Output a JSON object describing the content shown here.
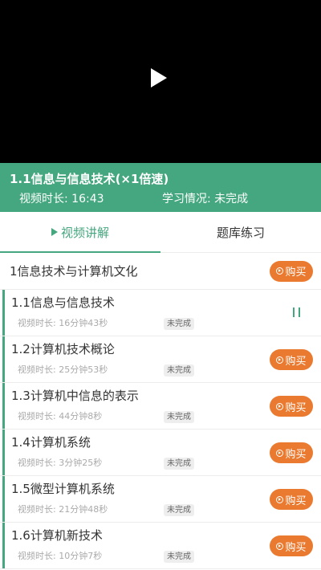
{
  "player": {
    "play_icon": "play-icon"
  },
  "info": {
    "title": "1.1信息与信息技术(×1倍速)",
    "duration_label": "视频时长:",
    "duration": "16:43",
    "progress_label": "学习情况:",
    "progress": "未完成"
  },
  "tabs": [
    {
      "label": "视频讲解",
      "active": true
    },
    {
      "label": "题库练习",
      "active": false
    }
  ],
  "chapter": {
    "title": "1信息技术与计算机文化",
    "buy_label": "购买"
  },
  "lessons": [
    {
      "name": "1.1信息与信息技术",
      "duration": "视频时长: 16分钟43秒",
      "status": "未完成",
      "action": "pause"
    },
    {
      "name": "1.2计算机技术概论",
      "duration": "视频时长: 25分钟53秒",
      "status": "未完成",
      "action": "buy",
      "buy_label": "购买"
    },
    {
      "name": "1.3计算机中信息的表示",
      "duration": "视频时长: 44分钟8秒",
      "status": "未完成",
      "action": "buy",
      "buy_label": "购买"
    },
    {
      "name": "1.4计算机系统",
      "duration": "视频时长: 3分钟25秒",
      "status": "未完成",
      "action": "buy",
      "buy_label": "购买"
    },
    {
      "name": "1.5微型计算机系统",
      "duration": "视频时长: 21分钟48秒",
      "status": "未完成",
      "action": "buy",
      "buy_label": "购买"
    },
    {
      "name": "1.6计算机新技术",
      "duration": "视频时长: 10分钟7秒",
      "status": "未完成",
      "action": "buy",
      "buy_label": "购买"
    }
  ],
  "colors": {
    "accent": "#45a77f",
    "buy": "#ea7a2f"
  }
}
